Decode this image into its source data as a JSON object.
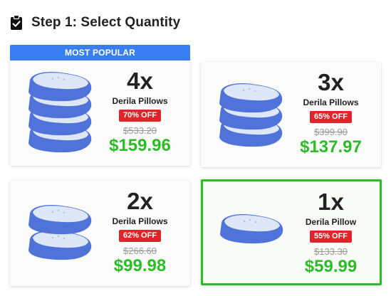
{
  "step": {
    "title": "Step 1: Select Quantity",
    "icon": "clipboard-check-icon"
  },
  "popular_label": "MOST POPULAR",
  "colors": {
    "accent_blue": "#3a7ff1",
    "sale_red": "#e0242a",
    "price_green": "#2bbd25",
    "pillow_blue": "#4f73d8"
  },
  "options": [
    {
      "qty": "4x",
      "name": "Derila Pillows",
      "discount": "70% OFF",
      "was": "$533.20",
      "price": "$159.96",
      "pillow_count": 4
    },
    {
      "qty": "3x",
      "name": "Derila Pillows",
      "discount": "65% OFF",
      "was": "$399.90",
      "price": "$137.97",
      "pillow_count": 3
    },
    {
      "qty": "2x",
      "name": "Derila Pillows",
      "discount": "62% OFF",
      "was": "$266.60",
      "price": "$99.98",
      "pillow_count": 2
    },
    {
      "qty": "1x",
      "name": "Derila Pillow",
      "discount": "55% OFF",
      "was": "$133.30",
      "price": "$59.99",
      "pillow_count": 1
    }
  ],
  "selected_option": "1x"
}
